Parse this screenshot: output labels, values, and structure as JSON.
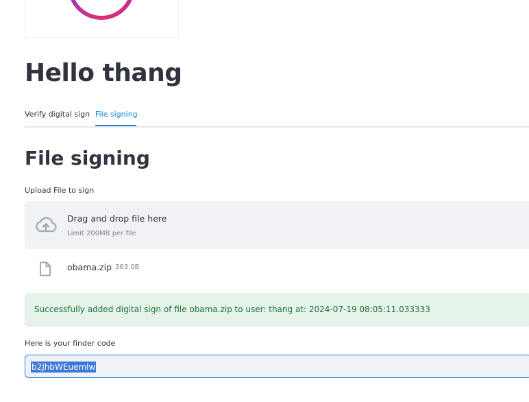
{
  "header": {
    "greeting": "Hello thang"
  },
  "tabs": [
    {
      "label": "Verify digital sign",
      "active": false
    },
    {
      "label": "File signing",
      "active": true
    }
  ],
  "main": {
    "title": "File signing",
    "upload": {
      "label": "Upload File to sign",
      "drop_title": "Drag and drop file here",
      "drop_limit": "Limit 200MB per file",
      "icon": "cloud-upload-icon"
    },
    "file": {
      "name": "obama.zip",
      "size": "363.0B",
      "icon": "file-icon"
    },
    "success_message": "Successfully added digital sign of file obama.zip to user: thang at: 2024-07-19 08:05:11.033333",
    "finder": {
      "label": "Here is your finder code",
      "value": "b2JhbWEuemlw"
    }
  },
  "colors": {
    "accent": "#1c83e1",
    "success_bg": "#e6f3ea",
    "success_text": "#177233",
    "input_bg": "#f0f2f6",
    "selection": "#3b78d8"
  }
}
